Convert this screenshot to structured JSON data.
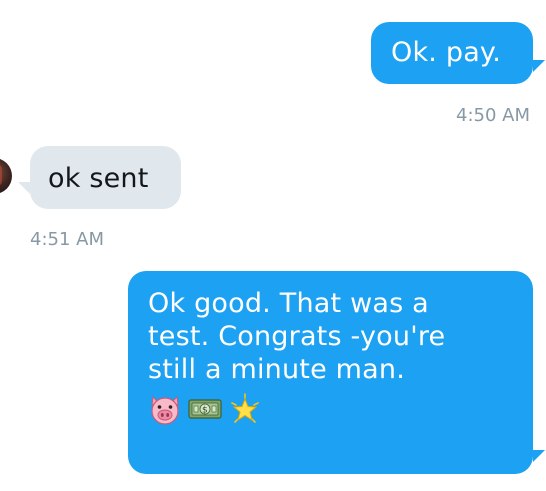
{
  "messages": [
    {
      "direction": "sent",
      "text": "Ok. pay.",
      "time": "4:50 AM"
    },
    {
      "direction": "received",
      "text": "ok sent",
      "time": "4:51 AM"
    },
    {
      "direction": "sent",
      "lines": [
        "Ok good. That was a",
        "test. Congrats -you're",
        "still a minute man."
      ],
      "emojis": [
        "pig-face-icon",
        "dollar-banknote-icon",
        "glowing-star-icon"
      ]
    }
  ],
  "colors": {
    "sent_bubble": "#1da1f2",
    "received_bubble": "#e1e8ed",
    "timestamp": "#8899a6"
  }
}
